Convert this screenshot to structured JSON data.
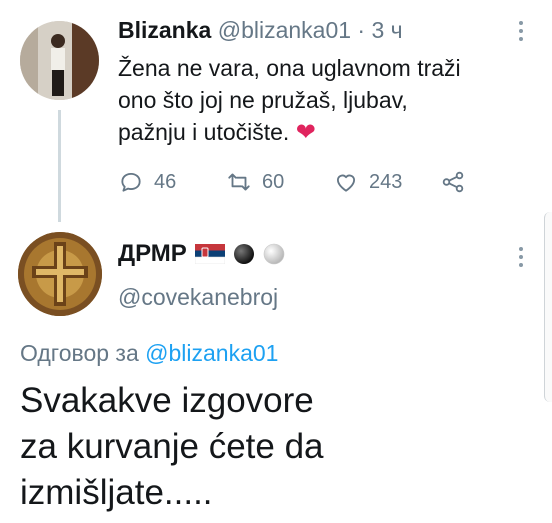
{
  "tweet": {
    "author_name": "Blizanka",
    "author_handle": "@blizanka01",
    "time_sep": " · ",
    "time": "3 ч",
    "body": "Žena ne vara, ona uglavnom traži\nono što joj ne pružaš, ljubav,\npažnju i utočište.",
    "emoji": "❤",
    "replies": "46",
    "retweets": "60",
    "likes": "243"
  },
  "reply": {
    "author_name": "ДРМР",
    "author_handle": "@covekanebroj",
    "reply_prefix": "Одговор за ",
    "reply_to": "@blizanka01",
    "body": "Svakakve izgovore\nza kurvanje ćete da\nizmišljate....."
  },
  "colors": {
    "link": "#1da1f2",
    "muted": "#657786",
    "heart": "#e0245e"
  },
  "icons": [
    "reply-icon",
    "retweet-icon",
    "like-icon",
    "share-icon",
    "more-icon",
    "serbian-flag-icon",
    "black-ball-icon",
    "white-ball-icon"
  ]
}
